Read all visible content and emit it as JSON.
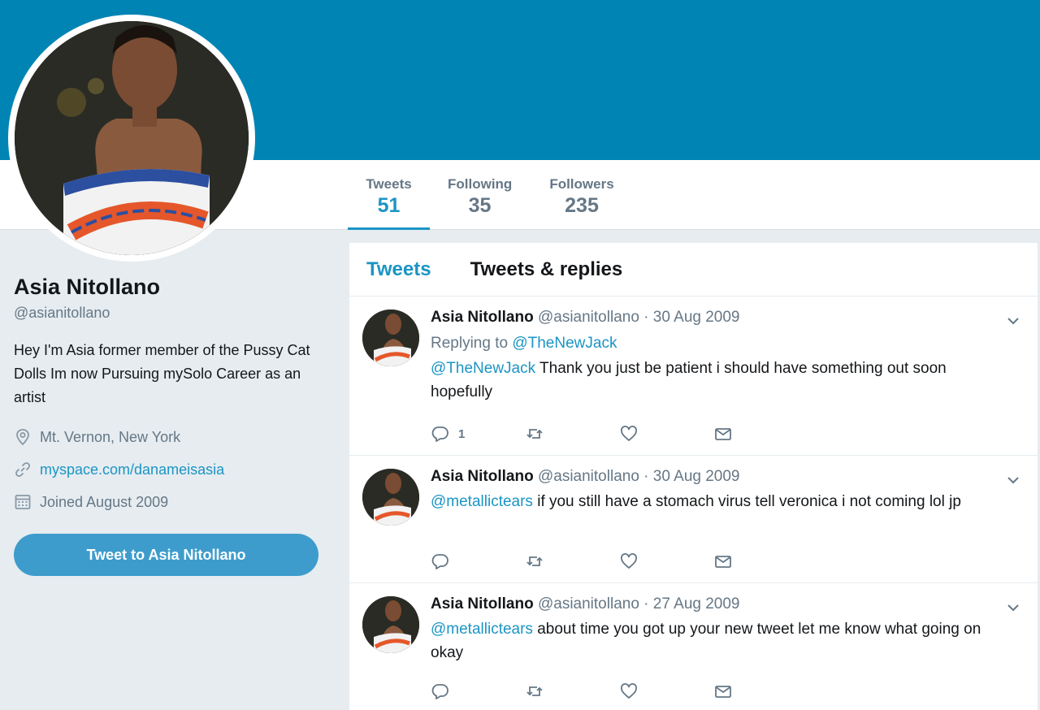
{
  "header": {
    "banner_color": "#0084b4",
    "accent_color": "#1b95c4"
  },
  "stats": [
    {
      "label": "Tweets",
      "value": "51",
      "active": true
    },
    {
      "label": "Following",
      "value": "35",
      "active": false
    },
    {
      "label": "Followers",
      "value": "235",
      "active": false
    }
  ],
  "profile": {
    "name": "Asia Nitollano",
    "handle": "@asianitollano",
    "bio": "Hey I'm Asia former member of the Pussy Cat Dolls Im now Pursuing mySolo Career as an artist",
    "location": "Mt. Vernon, New York",
    "website": "myspace.com/danameisasia",
    "joined": "Joined August 2009",
    "tweet_to_label": "Tweet to Asia Nitollano"
  },
  "timeline": {
    "tabs": [
      {
        "label": "Tweets",
        "active": true
      },
      {
        "label": "Tweets & replies",
        "active": false
      }
    ],
    "tweets": [
      {
        "name": "Asia Nitollano",
        "handle": "@asianitollano",
        "sep": "·",
        "time": "30 Aug 2009",
        "replying_prefix": "Replying to",
        "replying_to": "@TheNewJack",
        "mention": "@TheNewJack",
        "text": " Thank you  just be patient i should have something out soon hopefully",
        "reply_count": "1"
      },
      {
        "name": "Asia Nitollano",
        "handle": "@asianitollano",
        "sep": "·",
        "time": "30 Aug 2009",
        "mention": "@metallictears",
        "text": " if you still have a stomach virus tell veronica i not coming lol jp",
        "reply_count": ""
      },
      {
        "name": "Asia Nitollano",
        "handle": "@asianitollano",
        "sep": "·",
        "time": "27 Aug 2009",
        "mention": "@metallictears",
        "text": " about time you got up your new tweet let me know what going on okay",
        "reply_count": ""
      }
    ]
  },
  "icons": {
    "location": "location-pin-icon",
    "link": "link-icon",
    "calendar": "calendar-icon",
    "reply": "reply-icon",
    "retweet": "retweet-icon",
    "like": "heart-icon",
    "dm": "envelope-icon",
    "caret": "chevron-down-icon"
  }
}
